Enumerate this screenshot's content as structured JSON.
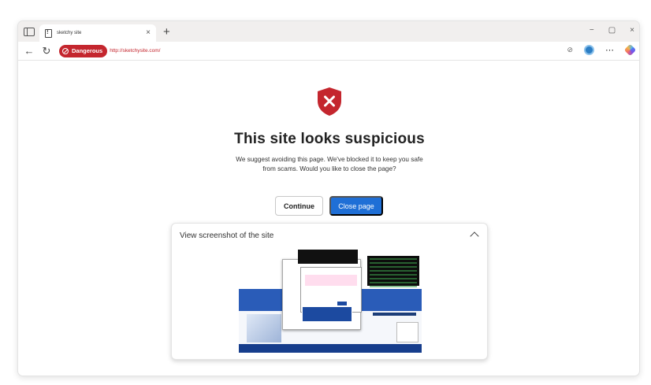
{
  "browser": {
    "tab_title": "sketchy site",
    "tab_close": "×",
    "new_tab": "+",
    "window_controls": [
      "−",
      "▢",
      "×"
    ],
    "address_badge": "Dangerous",
    "url": "http://sketchysite.com/",
    "icons": [
      "sidebar-toggle-icon",
      "site-favicon",
      "back-icon",
      "refresh-icon",
      "danger-icon",
      "tracking-prevention-icon",
      "profile-icon",
      "more-icon",
      "copilot-icon"
    ]
  },
  "warning": {
    "heading": "This site looks suspicious",
    "body": "We suggest avoiding this page. We've blocked it to keep you safe from scams. Would you like to close the page?",
    "continue_label": "Continue",
    "close_label": "Close page",
    "shield_color": "#c4262e",
    "accent_color": "#1f6fd6"
  },
  "screenshot_panel": {
    "title": "View screenshot of the site"
  }
}
